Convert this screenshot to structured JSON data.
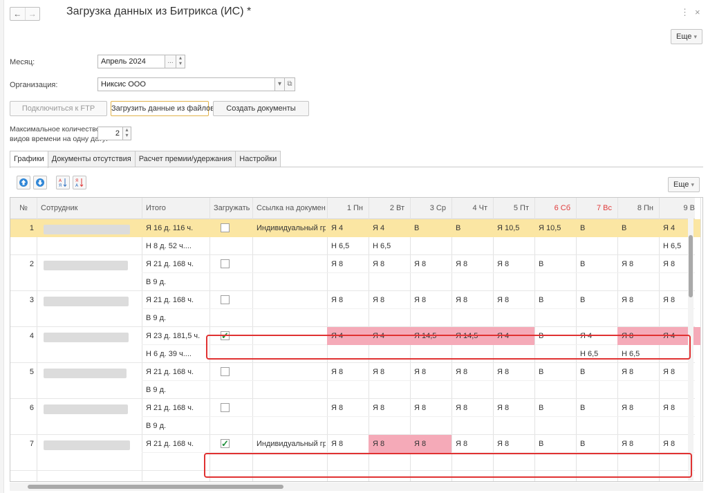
{
  "window": {
    "title": "Загрузка данных из Битрикса (ИС) *",
    "more": "Еще",
    "more_grid": "Еще"
  },
  "form": {
    "month_label": "Месяц:",
    "month_value": "Апрель 2024",
    "org_label": "Организация:",
    "org_value": "Никсис ООО",
    "btn_ftp": "Подключиться к FTP",
    "btn_load": "Загрузить данные из файлов",
    "btn_create": "Создать документы",
    "maxkinds_label_1": "Максимальное количество",
    "maxkinds_label_2": "видов времени на одну дату:",
    "maxkinds_value": "2"
  },
  "tabs": [
    "Графики",
    "Документы отсутствия",
    "Расчет премии/удержания",
    "Настройки"
  ],
  "columns": {
    "num": "№",
    "employee": "Сотрудник",
    "total": "Итого",
    "load": "Загружать",
    "doclink": "Ссылка на документ",
    "days": [
      "1 Пн",
      "2 Вт",
      "3 Ср",
      "4 Чт",
      "5 Пт",
      "6 Сб",
      "7 Вс",
      "8 Пн",
      "9 В"
    ]
  },
  "rows": [
    {
      "num": "1",
      "total": "Я 16 д. 116 ч.",
      "total2": "Н 8 д. 52 ч....",
      "checked": false,
      "doc": "Индивидуальный гра...",
      "days": [
        "Я 4",
        "Я 4",
        "В",
        "В",
        "Я 10,5",
        "Я 10,5",
        "В",
        "В",
        "Я 4"
      ],
      "days2": [
        "Н 6,5",
        "Н 6,5",
        "",
        "",
        "",
        "",
        "",
        "",
        "Н 6,5"
      ]
    },
    {
      "num": "2",
      "total": "Я 21 д. 168 ч.",
      "total2": "В 9 д.",
      "checked": false,
      "doc": "",
      "days": [
        "Я 8",
        "Я 8",
        "Я 8",
        "Я 8",
        "Я 8",
        "В",
        "В",
        "Я 8",
        "Я 8"
      ],
      "days2": [
        "",
        "",
        "",
        "",
        "",
        "",
        "",
        "",
        ""
      ]
    },
    {
      "num": "3",
      "total": "Я 21 д. 168 ч.",
      "total2": "В 9 д.",
      "checked": false,
      "doc": "",
      "days": [
        "Я 8",
        "Я 8",
        "Я 8",
        "Я 8",
        "Я 8",
        "В",
        "В",
        "Я 8",
        "Я 8"
      ],
      "days2": [
        "",
        "",
        "",
        "",
        "",
        "",
        "",
        "",
        ""
      ]
    },
    {
      "num": "4",
      "total": "Я 23 д. 181,5 ч.",
      "total2": "Н 6 д. 39 ч....",
      "checked": true,
      "doc": "",
      "days": [
        "Я 4",
        "Я 4",
        "Я 14,5",
        "Я 14,5",
        "Я 4",
        "В",
        "Я 4",
        "Я 8",
        "Я 4"
      ],
      "days2": [
        "",
        "",
        "",
        "",
        "",
        "",
        "Н 6,5",
        "Н 6,5",
        ""
      ]
    },
    {
      "num": "5",
      "total": "Я 21 д. 168 ч.",
      "total2": "В 9 д.",
      "checked": false,
      "doc": "",
      "days": [
        "Я 8",
        "Я 8",
        "Я 8",
        "Я 8",
        "Я 8",
        "В",
        "В",
        "Я 8",
        "Я 8"
      ],
      "days2": [
        "",
        "",
        "",
        "",
        "",
        "",
        "",
        "",
        ""
      ]
    },
    {
      "num": "6",
      "total": "Я 21 д. 168 ч.",
      "total2": "В 9 д.",
      "checked": false,
      "doc": "",
      "days": [
        "Я 8",
        "Я 8",
        "Я 8",
        "Я 8",
        "Я 8",
        "В",
        "В",
        "Я 8",
        "Я 8"
      ],
      "days2": [
        "",
        "",
        "",
        "",
        "",
        "",
        "",
        "",
        ""
      ]
    },
    {
      "num": "7",
      "total": "Я 21 д. 168 ч.",
      "total2": "",
      "checked": true,
      "doc": "Индивидуальный гра...",
      "days": [
        "Я 8",
        "Я 8",
        "Я 8",
        "Я 8",
        "Я 8",
        "В",
        "В",
        "Я 8",
        "Я 8"
      ],
      "days2": [
        "",
        "",
        "",
        "",
        "",
        "",
        "",
        "",
        ""
      ]
    }
  ],
  "colors": {
    "pink": "#f5aab8",
    "selected": "#fbe6a3",
    "weekend_header": "#e03b3b",
    "highlight_box": "#e03131"
  }
}
